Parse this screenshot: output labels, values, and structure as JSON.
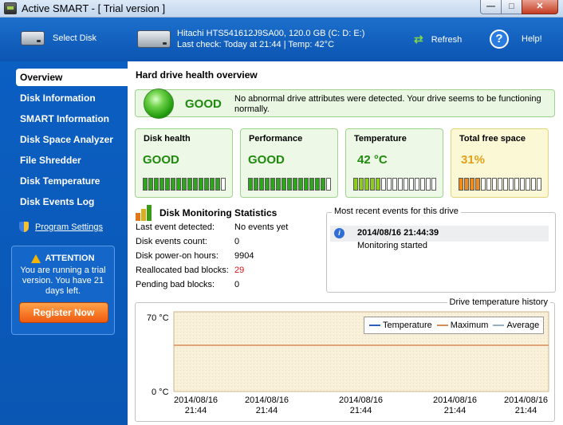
{
  "window": {
    "title": "Active SMART - [ Trial version ]",
    "min": "—",
    "max": "□",
    "close": "✕"
  },
  "toolbar": {
    "select_disk": "Select Disk",
    "drive_name": "Hitachi HTS541612J9SA00, 120.0 GB (C: D: E:)",
    "drive_status": "Last check: Today at 21:44 | Temp: 42°C",
    "refresh": "Refresh",
    "help": "Help!",
    "help_glyph": "?"
  },
  "sidebar": {
    "items": [
      {
        "label": "Overview"
      },
      {
        "label": "Disk Information"
      },
      {
        "label": "SMART Information"
      },
      {
        "label": "Disk Space Analyzer"
      },
      {
        "label": "File Shredder"
      },
      {
        "label": "Disk Temperature"
      },
      {
        "label": "Disk Events Log"
      }
    ],
    "program_settings": "Program Settings",
    "attention": {
      "title": "ATTENTION",
      "text": "You are running a trial version. You have 21 days left.",
      "register": "Register Now"
    }
  },
  "main": {
    "title": "Hard drive health overview",
    "banner": {
      "status": "GOOD",
      "message": "No abnormal drive attributes were detected. Your drive seems to be functioning normally."
    },
    "cards": [
      {
        "title": "Disk health",
        "value": "GOOD",
        "level": 0.93,
        "fill": "#2ea61b"
      },
      {
        "title": "Performance",
        "value": "GOOD",
        "level": 0.93,
        "fill": "#2ea61b"
      },
      {
        "title": "Temperature",
        "value": "42 °C",
        "level": 0.33,
        "fill": "#8ccd1b"
      },
      {
        "title": "Total free space",
        "value": "31%",
        "level": 0.27,
        "fill": "#f08a1a"
      }
    ],
    "stats": {
      "title": "Disk Monitoring Statistics",
      "rows": [
        {
          "label": "Last event detected:",
          "value": "No events yet"
        },
        {
          "label": "Disk events count:",
          "value": "0"
        },
        {
          "label": "Disk power-on hours:",
          "value": "9904"
        },
        {
          "label": "Reallocated bad blocks:",
          "value": "29"
        },
        {
          "label": "Pending bad blocks:",
          "value": "0"
        }
      ]
    },
    "events": {
      "title": "Most recent events for this drive",
      "time": "2014/08/16 21:44:39",
      "text": "Monitoring started"
    },
    "temp_history": {
      "title": "Drive temperature history",
      "y_top": "70 °C",
      "y_bottom": "0 °C",
      "legend": [
        {
          "name": "Temperature",
          "color": "#2b5fbf"
        },
        {
          "name": "Maximum",
          "color": "#d98c5a"
        },
        {
          "name": "Average",
          "color": "#8fb0c8"
        }
      ],
      "x_labels": [
        {
          "date": "2014/08/16",
          "time": "21:44"
        },
        {
          "date": "2014/08/16",
          "time": "21:44"
        },
        {
          "date": "2014/08/16",
          "time": "21:44"
        },
        {
          "date": "2014/08/16",
          "time": "21:44"
        },
        {
          "date": "2014/08/16",
          "time": "21:44"
        }
      ]
    }
  }
}
